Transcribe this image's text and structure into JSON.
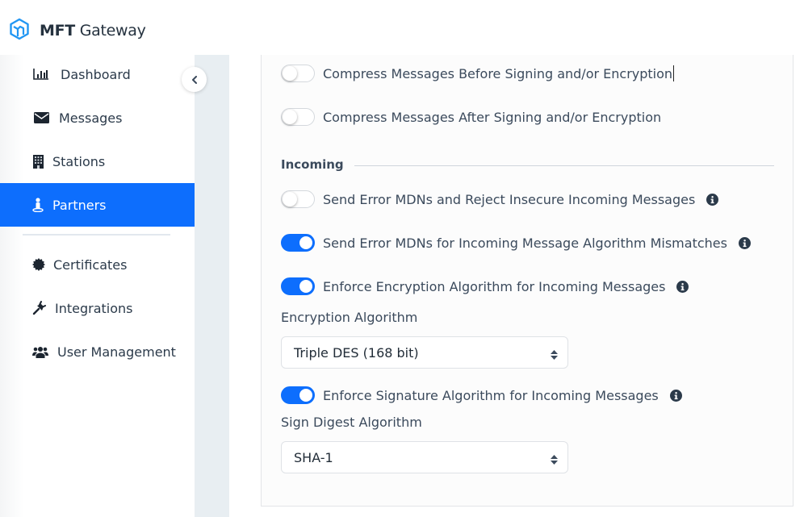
{
  "header": {
    "brand_bold": "MFT",
    "brand_light": " Gateway",
    "logo_icon": "hexagon-logo-icon",
    "accent_color": "#2196f3"
  },
  "sidebar": {
    "items": [
      {
        "label": "Dashboard",
        "icon": "bar-chart-icon",
        "active": false
      },
      {
        "label": "Messages",
        "icon": "envelope-icon",
        "active": false
      },
      {
        "label": "Stations",
        "icon": "building-icon",
        "active": false
      },
      {
        "label": "Partners",
        "icon": "user-pin-icon",
        "active": true
      },
      {
        "label": "Certificates",
        "icon": "certificate-icon",
        "active": false
      },
      {
        "label": "Integrations",
        "icon": "plug-icon",
        "active": false
      },
      {
        "label": "User Management",
        "icon": "users-icon",
        "active": false
      }
    ],
    "active_color": "#0d6efd",
    "collapse_icon": "chevron-left-icon"
  },
  "settings": {
    "outgoing": [
      {
        "label": "Compress Messages Before Signing and/or Encryption",
        "enabled": false,
        "info": false
      },
      {
        "label": "Compress Messages After Signing and/or Encryption",
        "enabled": false,
        "info": false
      }
    ],
    "incoming_title": "Incoming",
    "incoming": [
      {
        "label": "Send Error MDNs and Reject Insecure Incoming Messages",
        "enabled": false,
        "info": true
      },
      {
        "label": "Send Error MDNs for Incoming Message Algorithm Mismatches",
        "enabled": true,
        "info": true
      },
      {
        "label": "Enforce Encryption Algorithm for Incoming Messages",
        "enabled": true,
        "info": true
      }
    ],
    "encryption_algorithm": {
      "label": "Encryption Algorithm",
      "value": "Triple DES (168 bit)"
    },
    "signature_toggle": {
      "label": "Enforce Signature Algorithm for Incoming Messages",
      "enabled": true,
      "info": true
    },
    "sign_digest_algorithm": {
      "label": "Sign Digest Algorithm",
      "value": "SHA-1"
    }
  }
}
